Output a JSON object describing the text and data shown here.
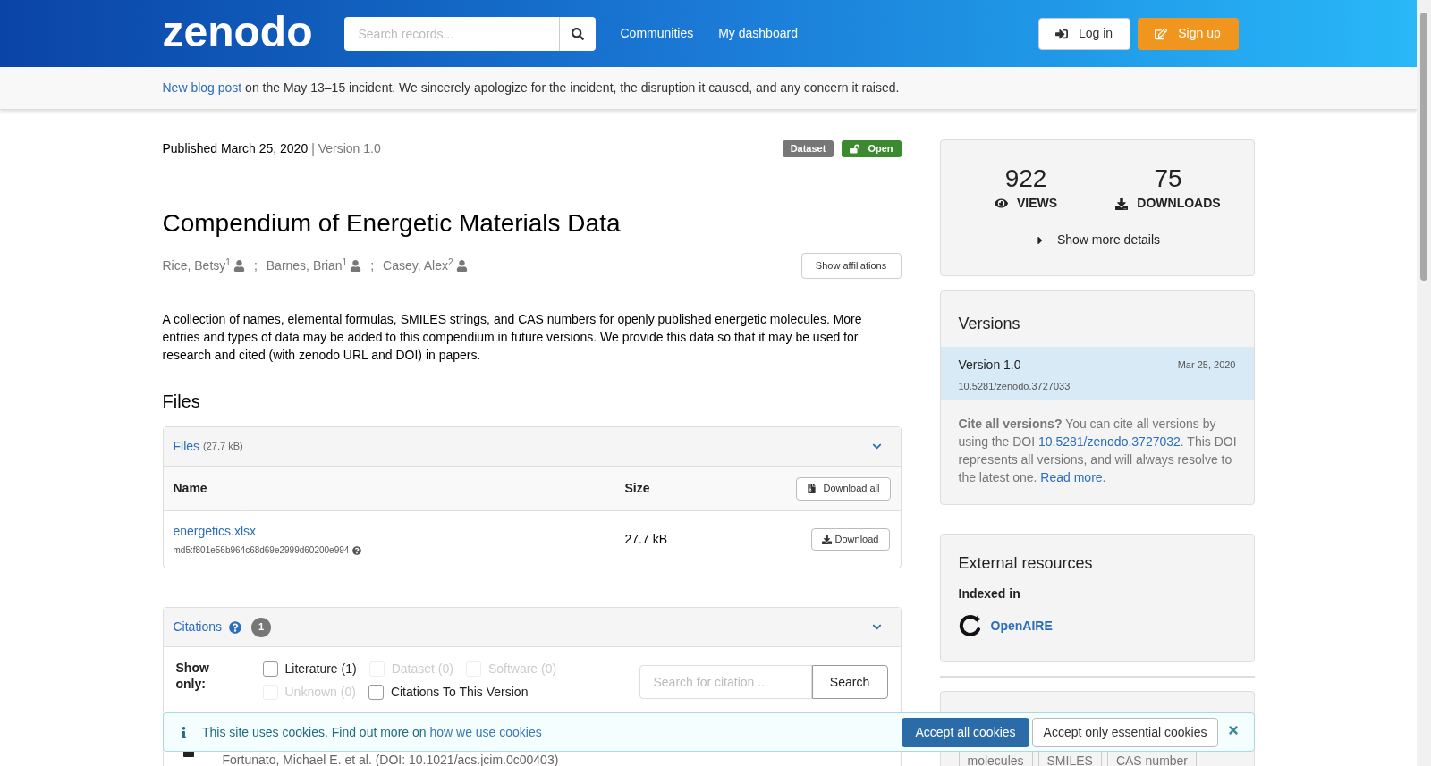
{
  "header": {
    "logo": "zenodo",
    "search_placeholder": "Search records...",
    "nav": [
      "Communities",
      "My dashboard"
    ],
    "login": "Log in",
    "signup": "Sign up"
  },
  "notice": {
    "link": "New blog post",
    "text": " on the May 13–15 incident. We sincerely apologize for the incident, the disruption it caused, and any concern it raised."
  },
  "record": {
    "published": "Published March 25, 2020",
    "version": "| Version 1.0",
    "badges": [
      {
        "label": "Dataset",
        "kind": "type"
      },
      {
        "label": "Open",
        "kind": "access"
      }
    ],
    "title": "Compendium of Energetic Materials Data",
    "authors": [
      "Rice, Betsy$^{1}$",
      "Barnes, Brian$^{1}$",
      "Casey, Alex$^{2}$"
    ],
    "author_separator": ";",
    "show_affiliations": "Show affiliations",
    "description": "A collection of names, elemental formulas, SMILES strings, and CAS numbers for openly published energetic molecules.  More entries and types of data may be added to this compendium in future versions.  We provide this data so that it may be used for research and cited (with zenodo URL and DOI) in papers."
  },
  "files": {
    "heading": "Files",
    "panel_title": "Files",
    "panel_size": "(27.7 kB)",
    "columns": [
      "Name",
      "Size"
    ],
    "download_all": "Download all",
    "rows": [
      {
        "name": "energetics.xlsx",
        "md5": "md5:f801e56b964c68d69e2999d60200e994",
        "size": "27.7 kB",
        "action": "Download"
      }
    ]
  },
  "citations": {
    "title": "Citations",
    "count": "1",
    "show_only": "Show only:",
    "filters": [
      {
        "label": "Literature (1)",
        "checked": false,
        "disabled": false
      },
      {
        "label": "Dataset (0)",
        "checked": false,
        "disabled": true
      },
      {
        "label": "Software (0)",
        "checked": false,
        "disabled": true
      },
      {
        "label": "Unknown (0)",
        "checked": false,
        "disabled": true
      },
      {
        "label": "Citations To This Version",
        "checked": false,
        "disabled": false
      }
    ],
    "search_placeholder": "Search for citation ...",
    "search_button": "Search",
    "rows": [
      {
        "authors": "Fortunato, Michael E. et al. (DOI: 10.1021/acs.jcim.0c00403)"
      }
    ]
  },
  "stats": {
    "views": "922",
    "views_label": "VIEWS",
    "downloads": "75",
    "downloads_label": "DOWNLOADS",
    "more": "Show more details"
  },
  "versions": {
    "heading": "Versions",
    "items": [
      {
        "name": "Version 1.0",
        "date": "Mar 25, 2020",
        "doi": "10.5281/zenodo.3727033",
        "selected": true
      }
    ],
    "cite_before": "**Cite all versions?** You can cite all versions by using the DOI ",
    "cite_doi": "10.5281/zenodo.3727032",
    "cite_after": ". This DOI represents all versions, and will always resolve to the latest one. ",
    "read_more": "Read more",
    "cite_end": "."
  },
  "external": {
    "heading": "External resources",
    "indexed_in": "Indexed in",
    "items": [
      "OpenAIRE"
    ]
  },
  "keywords": [
    "molecules",
    "SMILES",
    "CAS number"
  ],
  "cookies": {
    "text": "This site uses cookies. Find out more on ",
    "link": "how we use cookies",
    "accept_all": "Accept all cookies",
    "accept_essential": "Accept only essential cookies"
  }
}
